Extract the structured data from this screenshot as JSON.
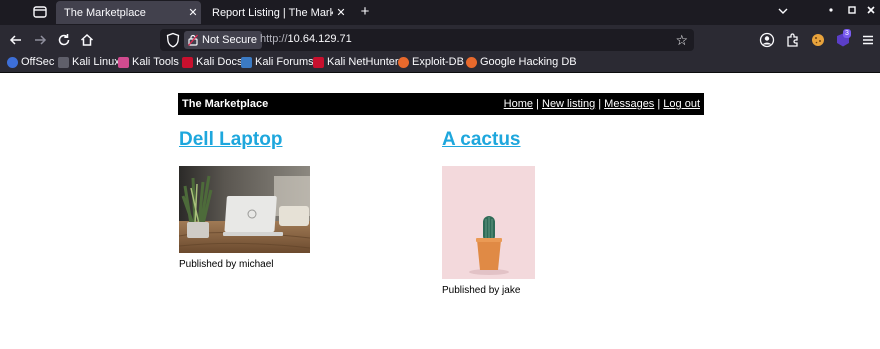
{
  "browser": {
    "tabs": [
      {
        "title": "The Marketplace",
        "active": true
      },
      {
        "title": "Report Listing | The Marketpl",
        "active": false
      }
    ],
    "url_security_label": "Not Secure",
    "url_scheme": "http://",
    "url_host": "10.64.129.71",
    "extension_badge": "3",
    "bookmarks": [
      {
        "label": "OffSec",
        "color": "#3d6fd8"
      },
      {
        "label": "Kali Linux",
        "color": "#5f5f6a"
      },
      {
        "label": "Kali Tools",
        "color": "#d14b8f"
      },
      {
        "label": "Kali Docs",
        "color": "#c8102e"
      },
      {
        "label": "Kali Forums",
        "color": "#3b7ac4"
      },
      {
        "label": "Kali NetHunter",
        "color": "#c8102e"
      },
      {
        "label": "Exploit-DB",
        "color": "#e8692c"
      },
      {
        "label": "Google Hacking DB",
        "color": "#e8692c"
      }
    ]
  },
  "site": {
    "title": "The Marketplace",
    "nav": [
      {
        "label": "Home"
      },
      {
        "label": "New listing"
      },
      {
        "label": "Messages"
      },
      {
        "label": "Log out"
      }
    ],
    "nav_separator": "|"
  },
  "listings": [
    {
      "title": "Dell Laptop",
      "publisher": "Published by michael",
      "image": "laptop-with-plant"
    },
    {
      "title": "A cactus",
      "publisher": "Published by jake",
      "image": "cactus-in-pot"
    }
  ],
  "colors": {
    "link": "#1ea7dd",
    "header_bg": "#000000",
    "chrome_dark": "#1c1b22",
    "chrome_mid": "#2b2a33"
  }
}
